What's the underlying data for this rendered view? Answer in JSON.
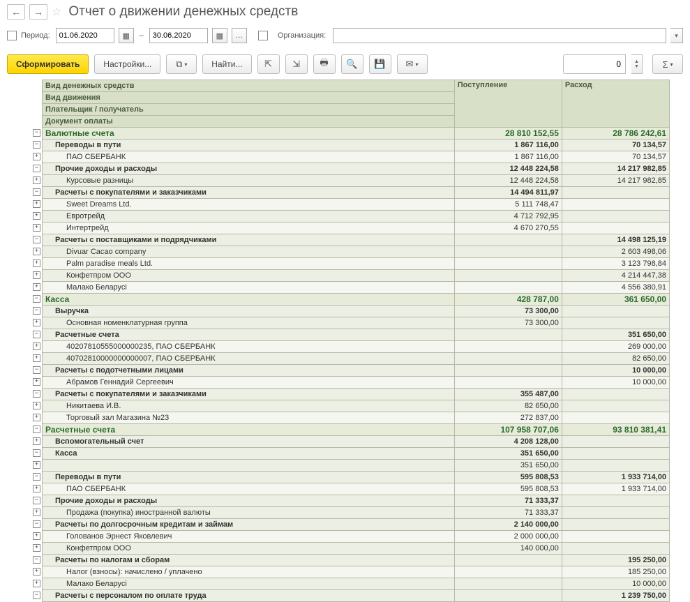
{
  "title": "Отчет о движении денежных средств",
  "period": {
    "label": "Период:",
    "from": "01.06.2020",
    "to": "30.06.2020"
  },
  "org_label": "Организация:",
  "toolbar": {
    "run": "Сформировать",
    "settings": "Настройки...",
    "find": "Найти...",
    "num": "0"
  },
  "headers": {
    "kind": "Вид денежных средств",
    "move": "Вид движения",
    "payer": "Плательщик / получатель",
    "doc": "Документ оплаты",
    "inc": "Поступление",
    "exp": "Расход"
  },
  "rows": [
    {
      "type": "section",
      "g": [
        "-"
      ],
      "label": "Валютные счета",
      "inc": "28 810 152,55",
      "exp": "28 786 242,61"
    },
    {
      "type": "group",
      "g": [
        "",
        "-"
      ],
      "label": "Переводы в пути",
      "inc": "1 867 116,00",
      "exp": "70 134,57"
    },
    {
      "type": "item",
      "g": [
        "",
        "",
        "+"
      ],
      "label": "ПАО СБЕРБАНК",
      "inc": "1 867 116,00",
      "exp": "70 134,57"
    },
    {
      "type": "group",
      "g": [
        "",
        "-"
      ],
      "label": "Прочие доходы и расходы",
      "inc": "12 448 224,58",
      "exp": "14 217 982,85"
    },
    {
      "type": "item",
      "g": [
        "",
        "",
        "+"
      ],
      "label": "Курсовые разницы",
      "inc": "12 448 224,58",
      "exp": "14 217 982,85"
    },
    {
      "type": "group",
      "g": [
        "",
        "-"
      ],
      "label": "Расчеты с покупателями и заказчиками",
      "inc": "14 494 811,97",
      "exp": ""
    },
    {
      "type": "item",
      "g": [
        "",
        "",
        "+"
      ],
      "label": "Sweet Dreams Ltd.",
      "inc": "5 111 748,47",
      "exp": ""
    },
    {
      "type": "item",
      "g": [
        "",
        "",
        "+"
      ],
      "label": "Евротрейд",
      "inc": "4 712 792,95",
      "exp": ""
    },
    {
      "type": "item",
      "g": [
        "",
        "",
        "+"
      ],
      "label": "Интертрейд",
      "inc": "4 670 270,55",
      "exp": ""
    },
    {
      "type": "group",
      "g": [
        "",
        "-"
      ],
      "label": "Расчеты с поставщиками и подрядчиками",
      "inc": "",
      "exp": "14 498 125,19"
    },
    {
      "type": "item",
      "g": [
        "",
        "",
        "+"
      ],
      "label": "Divuar Cacao company",
      "inc": "",
      "exp": "2 603 498,06"
    },
    {
      "type": "item",
      "g": [
        "",
        "",
        "+"
      ],
      "label": "Palm paradise meals Ltd.",
      "inc": "",
      "exp": "3 123 798,84"
    },
    {
      "type": "item",
      "g": [
        "",
        "",
        "+"
      ],
      "label": "Конфетпром ООО",
      "inc": "",
      "exp": "4 214 447,38"
    },
    {
      "type": "item",
      "g": [
        "",
        "",
        "+"
      ],
      "label": "Малако Беларусі",
      "inc": "",
      "exp": "4 556 380,91"
    },
    {
      "type": "section",
      "g": [
        "-"
      ],
      "label": "Касса",
      "inc": "428 787,00",
      "exp": "361 650,00"
    },
    {
      "type": "group",
      "g": [
        "",
        "-"
      ],
      "label": "Выручка",
      "inc": "73 300,00",
      "exp": ""
    },
    {
      "type": "item",
      "g": [
        "",
        "",
        "+"
      ],
      "label": "Основная номенклатурная группа",
      "inc": "73 300,00",
      "exp": ""
    },
    {
      "type": "group",
      "g": [
        "",
        "-"
      ],
      "label": "Расчетные счета",
      "inc": "",
      "exp": "351 650,00"
    },
    {
      "type": "item",
      "g": [
        "",
        "",
        "+"
      ],
      "label": "40207810555000000235, ПАО СБЕРБАНК",
      "inc": "",
      "exp": "269 000,00"
    },
    {
      "type": "item",
      "g": [
        "",
        "",
        "+"
      ],
      "label": "40702810000000000007, ПАО СБЕРБАНК",
      "inc": "",
      "exp": "82 650,00"
    },
    {
      "type": "group",
      "g": [
        "",
        "-"
      ],
      "label": "Расчеты с подотчетными лицами",
      "inc": "",
      "exp": "10 000,00"
    },
    {
      "type": "item",
      "g": [
        "",
        "",
        "+"
      ],
      "label": "Абрамов Геннадий Сергеевич",
      "inc": "",
      "exp": "10 000,00"
    },
    {
      "type": "group",
      "g": [
        "",
        "-"
      ],
      "label": "Расчеты с покупателями и заказчиками",
      "inc": "355 487,00",
      "exp": ""
    },
    {
      "type": "item",
      "g": [
        "",
        "",
        "+"
      ],
      "label": "Никитаева И.В.",
      "inc": "82 650,00",
      "exp": ""
    },
    {
      "type": "item",
      "g": [
        "",
        "",
        "+"
      ],
      "label": "Торговый зал Магазина №23",
      "inc": "272 837,00",
      "exp": ""
    },
    {
      "type": "section",
      "g": [
        "-"
      ],
      "label": "Расчетные счета",
      "inc": "107 958 707,06",
      "exp": "93 810 381,41"
    },
    {
      "type": "group",
      "g": [
        "",
        "+"
      ],
      "label": "Вспомогательный счет",
      "inc": "4 208 128,00",
      "exp": ""
    },
    {
      "type": "group",
      "g": [
        "",
        "-"
      ],
      "label": "Касса",
      "inc": "351 650,00",
      "exp": ""
    },
    {
      "type": "item",
      "g": [
        "",
        "",
        "+"
      ],
      "label": "",
      "inc": "351 650,00",
      "exp": ""
    },
    {
      "type": "group",
      "g": [
        "",
        "-"
      ],
      "label": "Переводы в пути",
      "inc": "595 808,53",
      "exp": "1 933 714,00"
    },
    {
      "type": "item",
      "g": [
        "",
        "",
        "+"
      ],
      "label": "ПАО СБЕРБАНК",
      "inc": "595 808,53",
      "exp": "1 933 714,00"
    },
    {
      "type": "group",
      "g": [
        "",
        "-"
      ],
      "label": "Прочие доходы и расходы",
      "inc": "71 333,37",
      "exp": ""
    },
    {
      "type": "item",
      "g": [
        "",
        "",
        "+"
      ],
      "label": "Продажа (покупка) иностранной валюты",
      "inc": "71 333,37",
      "exp": ""
    },
    {
      "type": "group",
      "g": [
        "",
        "-"
      ],
      "label": "Расчеты по долгосрочным кредитам и займам",
      "inc": "2 140 000,00",
      "exp": ""
    },
    {
      "type": "item",
      "g": [
        "",
        "",
        "+"
      ],
      "label": "Голованов Эрнест Яковлевич",
      "inc": "2 000 000,00",
      "exp": ""
    },
    {
      "type": "item",
      "g": [
        "",
        "",
        "+"
      ],
      "label": "Конфетпром ООО",
      "inc": "140 000,00",
      "exp": ""
    },
    {
      "type": "group",
      "g": [
        "",
        "-"
      ],
      "label": "Расчеты по налогам и сборам",
      "inc": "",
      "exp": "195 250,00"
    },
    {
      "type": "item",
      "g": [
        "",
        "",
        "+"
      ],
      "label": "Налог (взносы): начислено / уплачено",
      "inc": "",
      "exp": "185 250,00"
    },
    {
      "type": "item",
      "g": [
        "",
        "",
        "+"
      ],
      "label": "Малако Беларусі",
      "inc": "",
      "exp": "10 000,00"
    },
    {
      "type": "group",
      "g": [
        "",
        "-"
      ],
      "label": "Расчеты с персоналом по оплате труда",
      "inc": "",
      "exp": "1 239 750,00"
    }
  ]
}
